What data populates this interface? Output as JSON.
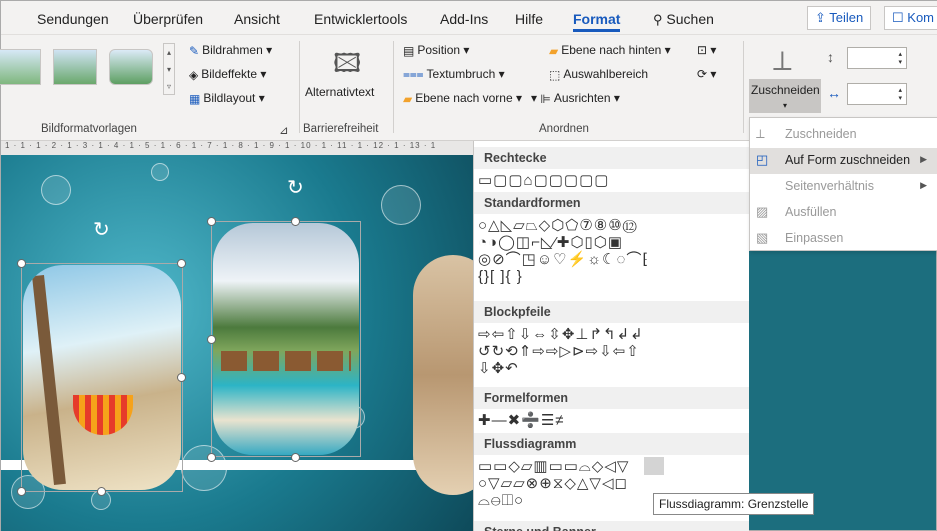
{
  "tabs": [
    "Sendungen",
    "Überprüfen",
    "Ansicht",
    "Entwicklertools",
    "Add-Ins",
    "Hilfe",
    "Format",
    "Suchen"
  ],
  "active_tab": "Format",
  "share_label": "Teilen",
  "comment_label": "Kom",
  "ribbon": {
    "bildrahmen": "Bildrahmen",
    "bildeffekte": "Bildeffekte",
    "bildlayout": "Bildlayout",
    "alternativtext": "Alternativtext",
    "position": "Position",
    "textumbruch": "Textumbruch",
    "ebene_vorne": "Ebene nach vorne",
    "ebene_hinten": "Ebene nach hinten",
    "auswahlbereich": "Auswahlbereich",
    "ausrichten": "Ausrichten",
    "zuschneiden": "Zuschneiden",
    "groups": {
      "bildformat": "Bildformatvorlagen",
      "barriere": "Barrierefreiheit",
      "anordnen": "Anordnen"
    }
  },
  "ruler": "1 · 1 · 1 · 2 · 1 · 3 · 1 · 4 · 1 · 5 · 1 · 6 · 1 · 7 · 1 · 8 · 1 · 9 · 1 · 10 · 1 · 11 · 1 · 12 · 1 · 13 · 1",
  "shapes_panel": {
    "categories": [
      {
        "name": "Rechtecke",
        "rows": [
          "▭▢▢⌂▢▢▢▢▢"
        ]
      },
      {
        "name": "Standardformen",
        "rows": [
          "○△◺▱⏢◇⬡⬠⑦⑧⑩⑫",
          "◔◑◯◫⌐◺⁄✚⬡▯⬡▣",
          "◎⊘⌒◳☺♡⚡☼☾◌⌒⁅",
          "{}[ ]{ }"
        ]
      },
      {
        "name": "Blockpfeile",
        "rows": [
          "⇨⇦⇧⇩⇔⇳✥⊥↱↰↲↲",
          "↺↻⟲⇑⇨⇨▷⊳⇨⇩⇦⇧",
          "⇩✥↶"
        ]
      },
      {
        "name": "Formelformen",
        "rows": [
          "✚—✖➗☰≠"
        ]
      },
      {
        "name": "Flussdiagramm",
        "rows": [
          "▭▭◇▱▥▭▭⌓◇◁▽",
          "○▽▱▱⊗⊕⧖◇△▽◁◻",
          "⌓⊖◫○"
        ]
      },
      {
        "name": "Sterne und Banner",
        "rows": []
      }
    ]
  },
  "crop_menu": {
    "items": [
      {
        "icon": "crop-icon",
        "label": "Zuschneiden",
        "enabled": false
      },
      {
        "icon": "crop-shape-icon",
        "label": "Auf Form zuschneiden",
        "enabled": true,
        "submenu": true
      },
      {
        "icon": "",
        "label": "Seitenverhältnis",
        "enabled": false,
        "submenu": true
      },
      {
        "icon": "fill-icon",
        "label": "Ausfüllen",
        "enabled": false
      },
      {
        "icon": "fit-icon",
        "label": "Einpassen",
        "enabled": false
      }
    ]
  },
  "tooltip": "Flussdiagramm: Grenzstelle"
}
